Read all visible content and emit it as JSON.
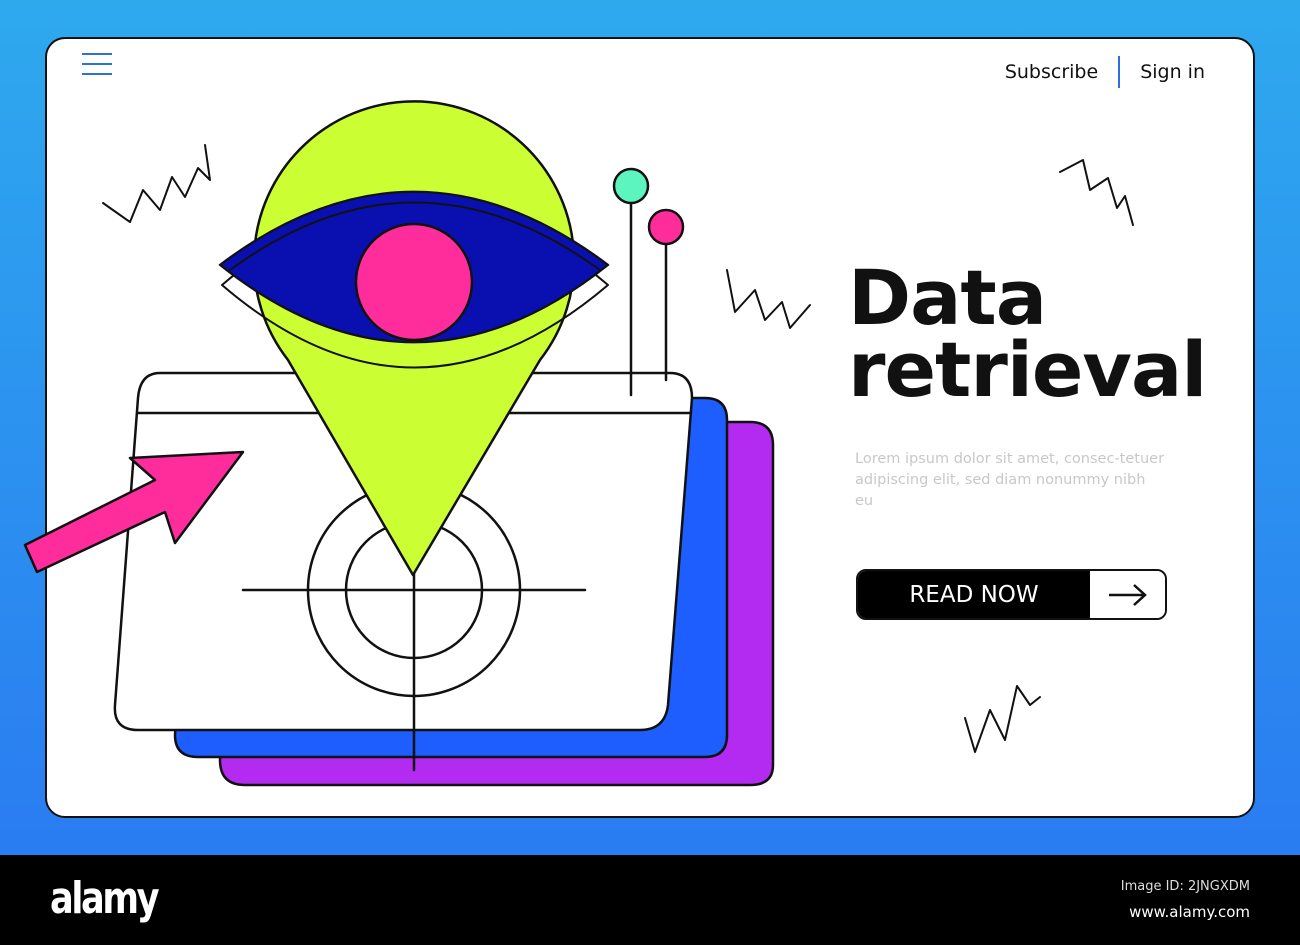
{
  "header": {
    "subscribe": "Subscribe",
    "sign_in": "Sign in",
    "menu_icon": "hamburger-icon"
  },
  "hero": {
    "title_line1": "Data",
    "title_line2": "retrieval",
    "body": "Lorem ipsum dolor sit amet, consec-tetuer adipiscing elit, sed diam nonummy nibh eu",
    "cta": "READ NOW",
    "cta_icon": "arrow-right-icon"
  },
  "colors": {
    "pin": "#ccff33",
    "eye": "#0a10b0",
    "iris": "#ff2d9b",
    "card_blue": "#1e5eff",
    "card_purple": "#b32af0",
    "dot_teal": "#5cf5c0",
    "accent": "#2c6fe0"
  },
  "footer": {
    "logo": "alamy",
    "image_id": "Image ID: 2JNGXDM",
    "url": "www.alamy.com"
  }
}
